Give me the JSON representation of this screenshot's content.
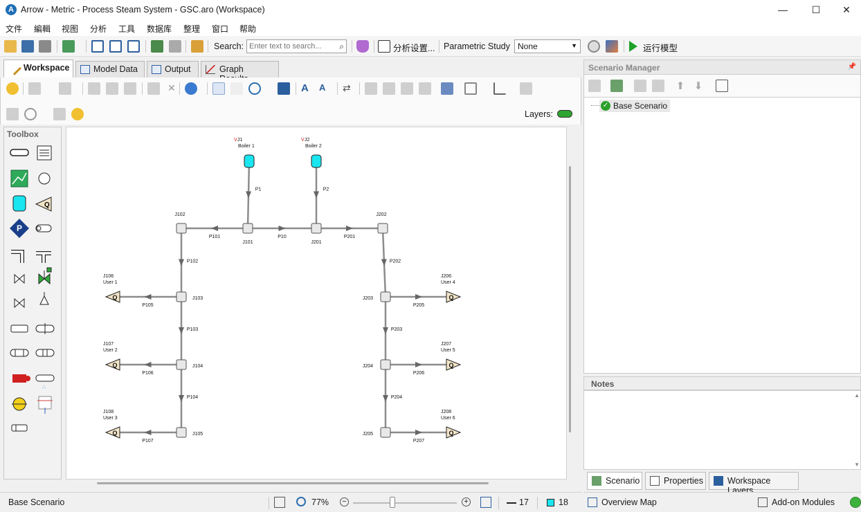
{
  "window": {
    "title": "Arrow - Metric - Process Steam System - GSC.aro (Workspace)",
    "app_icon_letter": "A",
    "minimize": "—",
    "maximize": "☐",
    "close": "✕"
  },
  "menu": [
    "文件",
    "編輯",
    "视图",
    "分析",
    "工具",
    "数据库",
    "整理",
    "窗口",
    "帮助"
  ],
  "toolbar": {
    "search_label": "Search:",
    "search_placeholder": "Enter text to search...",
    "analysis_settings": "分析设置...",
    "parametric_label": "Parametric Study",
    "parametric_value": "None",
    "run_label": "运行模型"
  },
  "tabs": [
    {
      "label": "Workspace",
      "active": true
    },
    {
      "label": "Model Data",
      "active": false
    },
    {
      "label": "Output",
      "active": false
    },
    {
      "label": "Graph Results",
      "active": false
    }
  ],
  "layers_label": "Layers:",
  "toolbox_title": "Toolbox",
  "diagram": {
    "nodes": [
      {
        "id": "J1",
        "name": "Boiler 1",
        "kind": "reservoir"
      },
      {
        "id": "J2",
        "name": "Boiler 2",
        "kind": "reservoir"
      },
      {
        "id": "J101",
        "kind": "tee"
      },
      {
        "id": "J102",
        "kind": "bend"
      },
      {
        "id": "J103",
        "kind": "tee"
      },
      {
        "id": "J104",
        "kind": "tee"
      },
      {
        "id": "J105",
        "kind": "bend"
      },
      {
        "id": "J106",
        "name": "User 1",
        "kind": "flow"
      },
      {
        "id": "J107",
        "name": "User 2",
        "kind": "flow"
      },
      {
        "id": "J108",
        "name": "User 3",
        "kind": "flow"
      },
      {
        "id": "J201",
        "kind": "tee"
      },
      {
        "id": "J202",
        "kind": "bend"
      },
      {
        "id": "J203",
        "kind": "tee"
      },
      {
        "id": "J204",
        "kind": "tee"
      },
      {
        "id": "J205",
        "kind": "bend"
      },
      {
        "id": "J206",
        "name": "User 4",
        "kind": "flow"
      },
      {
        "id": "J207",
        "name": "User 5",
        "kind": "flow"
      },
      {
        "id": "J208",
        "name": "User 6",
        "kind": "flow"
      }
    ],
    "pipes": [
      {
        "id": "P1",
        "from": "J1",
        "to": "J101"
      },
      {
        "id": "P2",
        "from": "J2",
        "to": "J201"
      },
      {
        "id": "P10",
        "from": "J101",
        "to": "J201"
      },
      {
        "id": "P101",
        "from": "J101",
        "to": "J102"
      },
      {
        "id": "P102",
        "from": "J102",
        "to": "J103"
      },
      {
        "id": "P103",
        "from": "J103",
        "to": "J104"
      },
      {
        "id": "P104",
        "from": "J104",
        "to": "J105"
      },
      {
        "id": "P105",
        "from": "J103",
        "to": "J106"
      },
      {
        "id": "P106",
        "from": "J104",
        "to": "J107"
      },
      {
        "id": "P107",
        "from": "J105",
        "to": "J108"
      },
      {
        "id": "P201",
        "from": "J201",
        "to": "J202"
      },
      {
        "id": "P202",
        "from": "J202",
        "to": "J203"
      },
      {
        "id": "P203",
        "from": "J203",
        "to": "J204"
      },
      {
        "id": "P204",
        "from": "J204",
        "to": "J205"
      },
      {
        "id": "P205",
        "from": "J203",
        "to": "J206"
      },
      {
        "id": "P206",
        "from": "J204",
        "to": "J207"
      },
      {
        "id": "P207",
        "from": "J205",
        "to": "J208"
      }
    ],
    "status_marker": "V",
    "pipe_color": "#8c8c8c",
    "reservoir_color": "#19e6f0",
    "flow_fill": "#f2e4c6"
  },
  "status": {
    "scenario": "Base Scenario",
    "zoom": "77%",
    "pipe_count": "17",
    "junction_count": "18",
    "zoom_fraction": 0.38
  },
  "scenario_manager": {
    "title": "Scenario Manager",
    "base": "Base Scenario"
  },
  "notes_title": "Notes",
  "bottom_tabs": [
    "Scenario",
    "Properties",
    "Workspace Layers"
  ],
  "overview_map": "Overview Map",
  "addon_modules": "Add-on Modules"
}
